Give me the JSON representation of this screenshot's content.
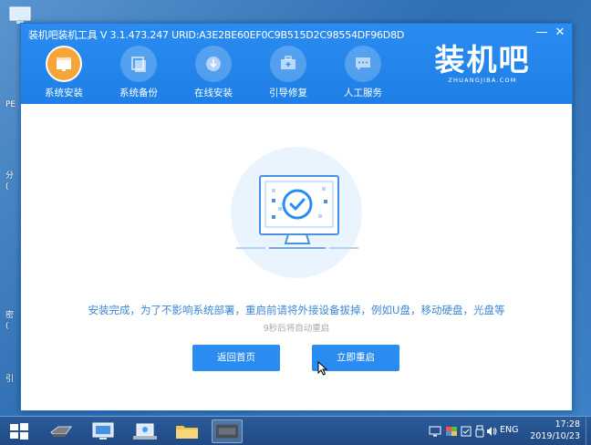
{
  "desktop": {
    "sidebar_labels": [
      "PE",
      "分",
      "(",
      "密",
      "(",
      "引"
    ]
  },
  "window": {
    "title": "装机吧装机工具 V 3.1.473.247 URID:A3E2BE60EF0C9B515D2C98554DF96D8D",
    "controls": {
      "minimize": "—",
      "close": "✕"
    }
  },
  "nav": {
    "items": [
      {
        "label": "系统安装",
        "icon": "monitor-window-icon",
        "active": true
      },
      {
        "label": "系统备份",
        "icon": "backup-stack-icon",
        "active": false
      },
      {
        "label": "在线安装",
        "icon": "download-disc-icon",
        "active": false
      },
      {
        "label": "引导修复",
        "icon": "repair-kit-icon",
        "active": false
      },
      {
        "label": "人工服务",
        "icon": "chat-bubble-icon",
        "active": false
      }
    ]
  },
  "brand": {
    "name": "装机吧",
    "domain": "ZHUANGJIBA.COM"
  },
  "content": {
    "message": "安装完成，为了不影响系统部署，重启前请将外接设备拔掉，例如U盘，移动硬盘，光盘等",
    "countdown": "9秒后将自动重启",
    "buttons": {
      "home": "返回首页",
      "restart": "立即重启"
    }
  },
  "taskbar": {
    "apps": [
      "drive-icon",
      "monitor-icon",
      "network-icon",
      "folder-icon",
      "zhuangjiba-app-icon"
    ],
    "tray": [
      "display-icon",
      "color-icon",
      "security-icon",
      "usb-icon",
      "volume-icon"
    ],
    "language": "ENG",
    "time": "17:28",
    "date": "2019/10/23"
  },
  "colors": {
    "accent": "#2a8cf0",
    "header": "#1e7fe6",
    "message": "#3c86d6",
    "subtext": "#a9a9a9",
    "illustration_bg": "#eaf4ff"
  }
}
